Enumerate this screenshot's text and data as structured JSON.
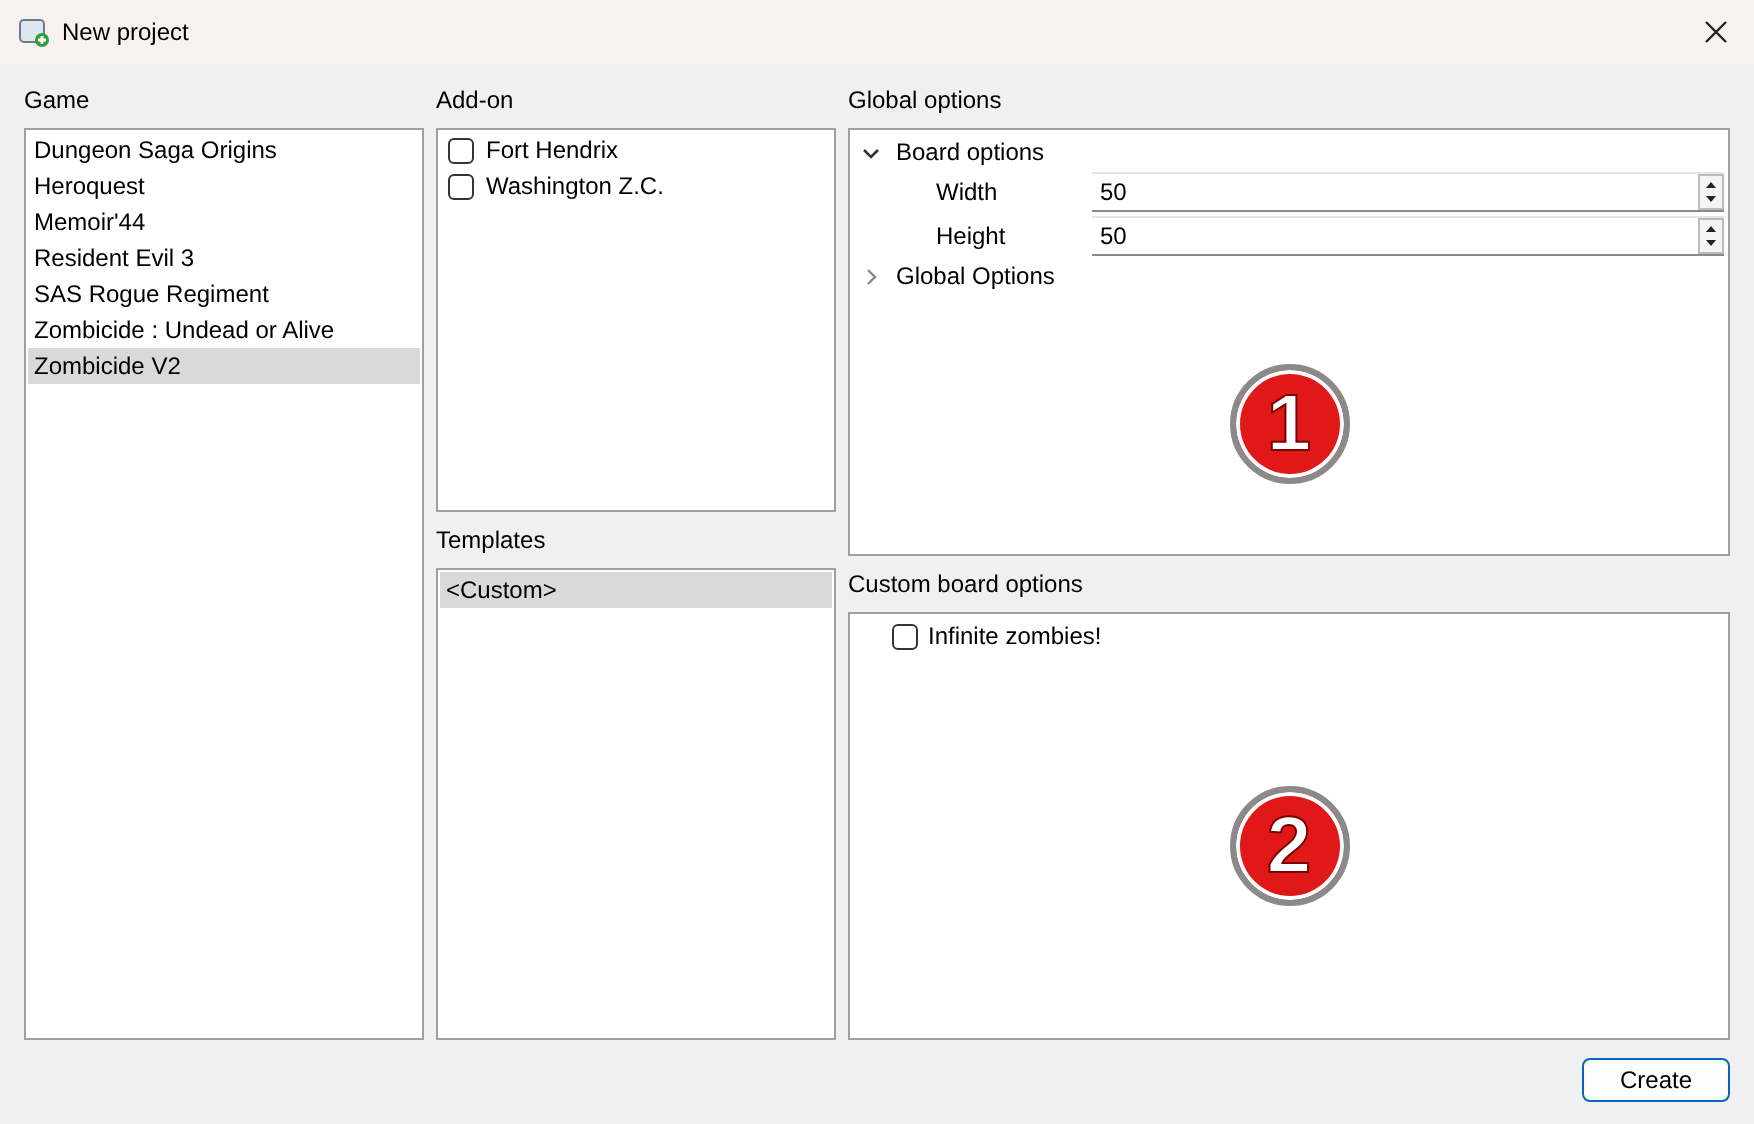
{
  "window": {
    "title": "New project"
  },
  "game": {
    "label": "Game",
    "items": [
      {
        "text": "Dungeon Saga Origins",
        "selected": false
      },
      {
        "text": "Heroquest",
        "selected": false
      },
      {
        "text": "Memoir'44",
        "selected": false
      },
      {
        "text": "Resident Evil 3",
        "selected": false
      },
      {
        "text": "SAS Rogue Regiment",
        "selected": false
      },
      {
        "text": "Zombicide : Undead or Alive",
        "selected": false
      },
      {
        "text": "Zombicide V2",
        "selected": true
      }
    ]
  },
  "addon": {
    "label": "Add-on",
    "items": [
      {
        "text": "Fort Hendrix",
        "checked": false
      },
      {
        "text": "Washington Z.C.",
        "checked": false
      }
    ]
  },
  "templates": {
    "label": "Templates",
    "items": [
      {
        "text": "<Custom>",
        "selected": true
      }
    ]
  },
  "global_options": {
    "label": "Global options",
    "marker": "1",
    "groups": [
      {
        "text": "Board options",
        "expanded": true,
        "children": [
          {
            "label": "Width",
            "value": "50"
          },
          {
            "label": "Height",
            "value": "50"
          }
        ]
      },
      {
        "text": "Global Options",
        "expanded": false
      }
    ]
  },
  "custom_board_options": {
    "label": "Custom board options",
    "marker": "2",
    "items": [
      {
        "text": "Infinite zombies!",
        "checked": false
      }
    ]
  },
  "buttons": [
    "Create"
  ]
}
